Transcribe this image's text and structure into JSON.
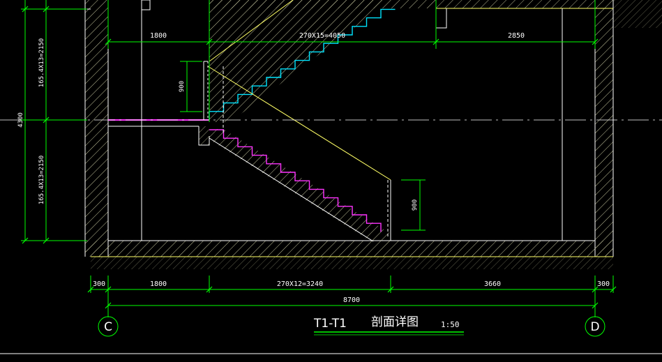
{
  "dimensions": {
    "top_left": "1800",
    "top_mid": "270X15=4050",
    "top_right": "2850",
    "left_upper": "165.4X13=2150",
    "left_lower": "165.4X13=2150",
    "left_total": "4300",
    "rail_upper": "900",
    "rail_lower": "900",
    "bottom_wall_left": "300",
    "bottom_left": "1800",
    "bottom_mid": "270X12=3240",
    "bottom_right": "3660",
    "bottom_wall_right": "300",
    "bottom_total": "8700"
  },
  "axes": {
    "left": "C",
    "right": "D"
  },
  "title": {
    "name": "T1-T1",
    "subtitle": "剖面详图",
    "scale": "1:50"
  },
  "colors": {
    "background": "#000000",
    "dimension_line": "#00ff00",
    "hatch": "#e8e8a0",
    "wall_line": "#ffffff",
    "upper_flight": "#00e5ff",
    "lower_flight": "#ff33ff",
    "slab_line": "#ffff66"
  }
}
